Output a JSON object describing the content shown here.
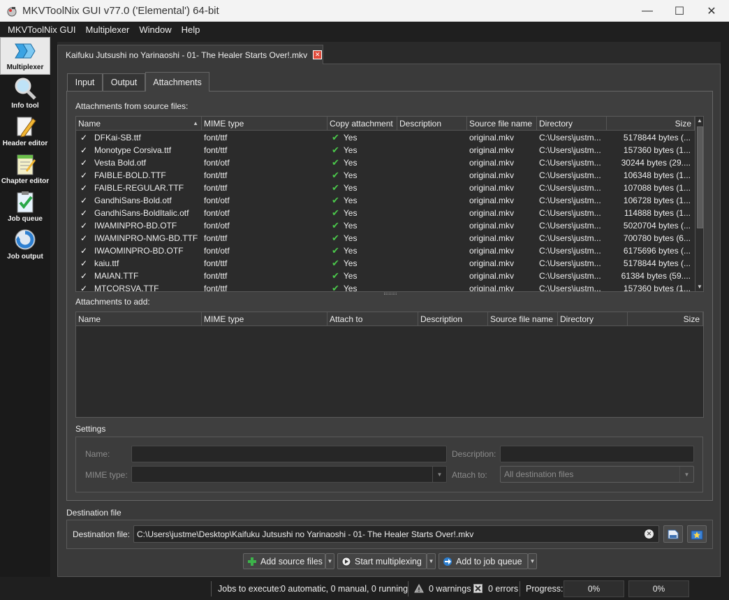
{
  "window": {
    "title": "MKVToolNix GUI v77.0 ('Elemental') 64-bit",
    "controls": {
      "minimize": "—",
      "maximize": "☐",
      "close": "✕"
    }
  },
  "menu": [
    "MKVToolNix GUI",
    "Multiplexer",
    "Window",
    "Help"
  ],
  "sidebar": {
    "items": [
      {
        "label": "Multiplexer",
        "icon": "multiplexer-icon",
        "active": true
      },
      {
        "label": "Info tool",
        "icon": "magnifier-icon"
      },
      {
        "label": "Header editor",
        "icon": "pencil-icon"
      },
      {
        "label": "Chapter editor",
        "icon": "notepad-icon"
      },
      {
        "label": "Job queue",
        "icon": "checklist-icon"
      },
      {
        "label": "Job output",
        "icon": "gear-cycle-icon"
      }
    ]
  },
  "file_tab": {
    "label": "Kaifuku Jutsushi no Yarinaoshi - 01- The Healer Starts Over!.mkv",
    "close": "✕"
  },
  "subtabs": [
    "Input",
    "Output",
    "Attachments"
  ],
  "source_section": {
    "label": "Attachments from source files:",
    "columns": [
      "Name",
      "MIME type",
      "Copy attachment",
      "Description",
      "Source file name",
      "Directory",
      "Size"
    ],
    "rows": [
      {
        "name": "DFKai-SB.ttf",
        "mime": "font/ttf",
        "copy": "Yes",
        "desc": "",
        "source": "original.mkv",
        "dir": "C:\\Users\\justm...",
        "size": "5178844 bytes (..."
      },
      {
        "name": "Monotype Corsiva.ttf",
        "mime": "font/ttf",
        "copy": "Yes",
        "desc": "",
        "source": "original.mkv",
        "dir": "C:\\Users\\justm...",
        "size": "157360 bytes (1..."
      },
      {
        "name": "Vesta Bold.otf",
        "mime": "font/otf",
        "copy": "Yes",
        "desc": "",
        "source": "original.mkv",
        "dir": "C:\\Users\\justm...",
        "size": "30244 bytes (29...."
      },
      {
        "name": "FAIBLE-BOLD.TTF",
        "mime": "font/ttf",
        "copy": "Yes",
        "desc": "",
        "source": "original.mkv",
        "dir": "C:\\Users\\justm...",
        "size": "106348 bytes (1..."
      },
      {
        "name": "FAIBLE-REGULAR.TTF",
        "mime": "font/ttf",
        "copy": "Yes",
        "desc": "",
        "source": "original.mkv",
        "dir": "C:\\Users\\justm...",
        "size": "107088 bytes (1..."
      },
      {
        "name": "GandhiSans-Bold.otf",
        "mime": "font/otf",
        "copy": "Yes",
        "desc": "",
        "source": "original.mkv",
        "dir": "C:\\Users\\justm...",
        "size": "106728 bytes (1..."
      },
      {
        "name": "GandhiSans-BoldItalic.otf",
        "mime": "font/otf",
        "copy": "Yes",
        "desc": "",
        "source": "original.mkv",
        "dir": "C:\\Users\\justm...",
        "size": "114888 bytes (1..."
      },
      {
        "name": "IWAMINPRO-BD.OTF",
        "mime": "font/otf",
        "copy": "Yes",
        "desc": "",
        "source": "original.mkv",
        "dir": "C:\\Users\\justm...",
        "size": "5020704 bytes (..."
      },
      {
        "name": "IWAMINPRO-NMG-BD.TTF",
        "mime": "font/ttf",
        "copy": "Yes",
        "desc": "",
        "source": "original.mkv",
        "dir": "C:\\Users\\justm...",
        "size": "700780 bytes (6..."
      },
      {
        "name": "IWAOMINPRO-BD.OTF",
        "mime": "font/otf",
        "copy": "Yes",
        "desc": "",
        "source": "original.mkv",
        "dir": "C:\\Users\\justm...",
        "size": "6175696 bytes (..."
      },
      {
        "name": "kaiu.ttf",
        "mime": "font/ttf",
        "copy": "Yes",
        "desc": "",
        "source": "original.mkv",
        "dir": "C:\\Users\\justm...",
        "size": "5178844 bytes (..."
      },
      {
        "name": "MAIAN.TTF",
        "mime": "font/ttf",
        "copy": "Yes",
        "desc": "",
        "source": "original.mkv",
        "dir": "C:\\Users\\justm...",
        "size": "61384 bytes (59...."
      },
      {
        "name": "MTCORSVA.TTF",
        "mime": "font/ttf",
        "copy": "Yes",
        "desc": "",
        "source": "original.mkv",
        "dir": "C:\\Users\\justm...",
        "size": "157360 bytes (1..."
      }
    ]
  },
  "add_section": {
    "label": "Attachments to add:",
    "columns": [
      "Name",
      "MIME type",
      "Attach to",
      "Description",
      "Source file name",
      "Directory",
      "Size"
    ]
  },
  "settings": {
    "label": "Settings",
    "name_label": "Name:",
    "description_label": "Description:",
    "mime_label": "MIME type:",
    "attach_to_label": "Attach to:",
    "attach_to_value": "All destination files"
  },
  "destination": {
    "section_label": "Destination file",
    "field_label": "Destination file:",
    "value": "C:\\Users\\justme\\Desktop\\Kaifuku Jutsushi no Yarinaoshi - 01- The Healer Starts Over!.mkv"
  },
  "buttons": {
    "add_source": "Add source files",
    "start": "Start multiplexing",
    "add_queue": "Add to job queue"
  },
  "status": {
    "jobs_label": "Jobs to execute:",
    "jobs_value": "0 automatic, 0 manual, 0 running",
    "warnings": "0 warnings",
    "errors": "0 errors",
    "progress_label": "Progress:",
    "progress_current": "0%",
    "progress_total": "0%"
  }
}
